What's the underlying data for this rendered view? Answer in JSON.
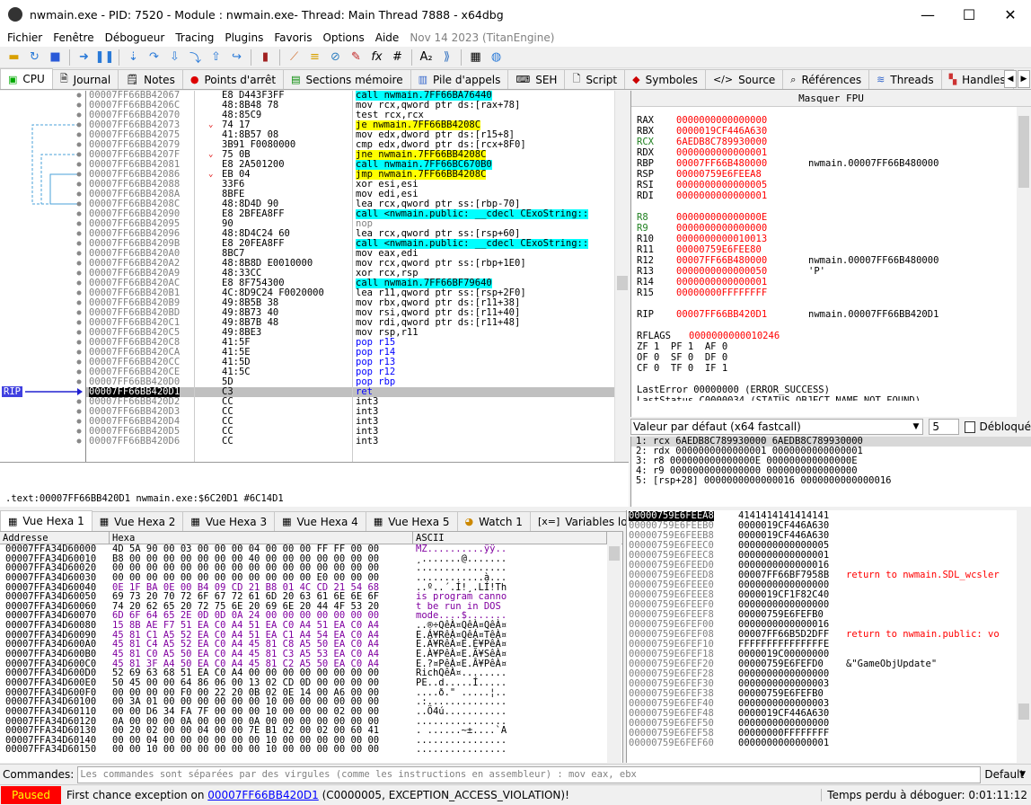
{
  "window": {
    "title": "nwmain.exe - PID: 7520 - Module : nwmain.exe- Thread: Main Thread 7888 - x64dbg",
    "minimize": "—",
    "maximize": "☐",
    "close": "✕"
  },
  "menu": [
    "Fichier",
    "Fenêtre",
    "Débogueur",
    "Tracing",
    "Plugins",
    "Favoris",
    "Options",
    "Aide"
  ],
  "menu_info": "Nov 14 2023 (TitanEngine)",
  "tabs": [
    {
      "label": "CPU",
      "icon": "cpu-icon"
    },
    {
      "label": "Journal",
      "icon": "journal-icon"
    },
    {
      "label": "Notes",
      "icon": "notes-icon"
    },
    {
      "label": "Points d'arrêt",
      "icon": "breakpoint-icon"
    },
    {
      "label": "Sections mémoire",
      "icon": "memory-icon"
    },
    {
      "label": "Pile d'appels",
      "icon": "callstack-icon"
    },
    {
      "label": "SEH",
      "icon": "seh-icon"
    },
    {
      "label": "Script",
      "icon": "script-icon"
    },
    {
      "label": "Symboles",
      "icon": "symbols-icon"
    },
    {
      "label": "Source",
      "icon": "source-icon"
    },
    {
      "label": "Références",
      "icon": "references-icon"
    },
    {
      "label": "Threads",
      "icon": "threads-icon"
    },
    {
      "label": "Handles",
      "icon": "handles-icon"
    }
  ],
  "rip_label": "RIP",
  "disasm": [
    {
      "a": "00007FF66BB42067",
      "b": "E8 D443F3FF",
      "i": "call nwmain.7FF66BA76440",
      "k": "call"
    },
    {
      "a": "00007FF66BB4206C",
      "b": "48:8B48 78",
      "i": "mov rcx,qword ptr ds:[rax+78]",
      "k": ""
    },
    {
      "a": "00007FF66BB42070",
      "b": "48:85C9",
      "i": "test rcx,rcx",
      "k": ""
    },
    {
      "a": "00007FF66BB42073",
      "b": "74 17",
      "i": "je nwmain.7FF66BB4208C",
      "k": "jmp"
    },
    {
      "a": "00007FF66BB42075",
      "b": "41:8B57 08",
      "i": "mov edx,dword ptr ds:[r15+8]",
      "k": ""
    },
    {
      "a": "00007FF66BB42079",
      "b": "3B91 F0080000",
      "i": "cmp edx,dword ptr ds:[rcx+8F0]",
      "k": ""
    },
    {
      "a": "00007FF66BB4207F",
      "b": "75 0B",
      "i": "jne nwmain.7FF66BB4208C",
      "k": "jmp"
    },
    {
      "a": "00007FF66BB42081",
      "b": "E8 2A501200",
      "i": "call nwmain.7FF66BC670B0",
      "k": "call"
    },
    {
      "a": "00007FF66BB42086",
      "b": "EB 04",
      "i": "jmp nwmain.7FF66BB4208C",
      "k": "jmp"
    },
    {
      "a": "00007FF66BB42088",
      "b": "33F6",
      "i": "xor esi,esi",
      "k": ""
    },
    {
      "a": "00007FF66BB4208A",
      "b": "8BFE",
      "i": "mov edi,esi",
      "k": ""
    },
    {
      "a": "00007FF66BB4208C",
      "b": "48:8D4D 90",
      "i": "lea rcx,qword ptr ss:[rbp-70]",
      "k": ""
    },
    {
      "a": "00007FF66BB42090",
      "b": "E8 2BFEA8FF",
      "i": "call <nwmain.public: __cdecl CExoString::",
      "k": "call"
    },
    {
      "a": "00007FF66BB42095",
      "b": "90",
      "i": "nop",
      "k": "nop"
    },
    {
      "a": "00007FF66BB42096",
      "b": "48:8D4C24 60",
      "i": "lea rcx,qword ptr ss:[rsp+60]",
      "k": ""
    },
    {
      "a": "00007FF66BB4209B",
      "b": "E8 20FEA8FF",
      "i": "call <nwmain.public: __cdecl CExoString::",
      "k": "call"
    },
    {
      "a": "00007FF66BB420A0",
      "b": "8BC7",
      "i": "mov eax,edi",
      "k": ""
    },
    {
      "a": "00007FF66BB420A2",
      "b": "48:8B8D E0010000",
      "i": "mov rcx,qword ptr ss:[rbp+1E0]",
      "k": ""
    },
    {
      "a": "00007FF66BB420A9",
      "b": "48:33CC",
      "i": "xor rcx,rsp",
      "k": ""
    },
    {
      "a": "00007FF66BB420AC",
      "b": "E8 8F754300",
      "i": "call nwmain.7FF66BF79640",
      "k": "call"
    },
    {
      "a": "00007FF66BB420B1",
      "b": "4C:8D9C24 F0020000",
      "i": "lea r11,qword ptr ss:[rsp+2F0]",
      "k": ""
    },
    {
      "a": "00007FF66BB420B9",
      "b": "49:8B5B 38",
      "i": "mov rbx,qword ptr ds:[r11+38]",
      "k": ""
    },
    {
      "a": "00007FF66BB420BD",
      "b": "49:8B73 40",
      "i": "mov rsi,qword ptr ds:[r11+40]",
      "k": ""
    },
    {
      "a": "00007FF66BB420C1",
      "b": "49:8B7B 48",
      "i": "mov rdi,qword ptr ds:[r11+48]",
      "k": ""
    },
    {
      "a": "00007FF66BB420C5",
      "b": "49:8BE3",
      "i": "mov rsp,r11",
      "k": ""
    },
    {
      "a": "00007FF66BB420C8",
      "b": "41:5F",
      "i": "pop r15",
      "k": "pop"
    },
    {
      "a": "00007FF66BB420CA",
      "b": "41:5E",
      "i": "pop r14",
      "k": "pop"
    },
    {
      "a": "00007FF66BB420CC",
      "b": "41:5D",
      "i": "pop r13",
      "k": "pop"
    },
    {
      "a": "00007FF66BB420CE",
      "b": "41:5C",
      "i": "pop r12",
      "k": "pop"
    },
    {
      "a": "00007FF66BB420D0",
      "b": "5D",
      "i": "pop rbp",
      "k": "pop"
    },
    {
      "a": "00007FF66BB420D1",
      "b": "C3",
      "i": "ret",
      "k": "ret",
      "cur": true
    },
    {
      "a": "00007FF66BB420D2",
      "b": "CC",
      "i": "int3",
      "k": ""
    },
    {
      "a": "00007FF66BB420D3",
      "b": "CC",
      "i": "int3",
      "k": ""
    },
    {
      "a": "00007FF66BB420D4",
      "b": "CC",
      "i": "int3",
      "k": ""
    },
    {
      "a": "00007FF66BB420D5",
      "b": "CC",
      "i": "int3",
      "k": ""
    },
    {
      "a": "00007FF66BB420D6",
      "b": "CC",
      "i": "int3",
      "k": ""
    }
  ],
  "regs_header": "Masquer FPU",
  "regs": [
    {
      "n": "RAX",
      "v": "0000000000000000",
      "c": ""
    },
    {
      "n": "RBX",
      "v": "0000019CF446A630",
      "c": ""
    },
    {
      "n": "RCX",
      "v": "6AEDB8C789930000",
      "c": ""
    },
    {
      "n": "RDX",
      "v": "0000000000000001",
      "c": ""
    },
    {
      "n": "RBP",
      "v": "00007FF66B480000",
      "c": "nwmain.00007FF66B480000"
    },
    {
      "n": "RSP",
      "v": "00000759E6FEEA8",
      "c": ""
    },
    {
      "n": "RSI",
      "v": "0000000000000005",
      "c": ""
    },
    {
      "n": "RDI",
      "v": "0000000000000001",
      "c": ""
    },
    {
      "n": "R8",
      "v": "000000000000000E",
      "c": ""
    },
    {
      "n": "R9",
      "v": "0000000000000000",
      "c": ""
    },
    {
      "n": "R10",
      "v": "0000000000010013",
      "c": ""
    },
    {
      "n": "R11",
      "v": "00000759E6FEE80",
      "c": ""
    },
    {
      "n": "R12",
      "v": "00007FF66B480000",
      "c": "nwmain.00007FF66B480000"
    },
    {
      "n": "R13",
      "v": "0000000000000050",
      "c": "'P'"
    },
    {
      "n": "R14",
      "v": "0000000000000001",
      "c": ""
    },
    {
      "n": "R15",
      "v": "00000000FFFFFFFF",
      "c": ""
    },
    {
      "n": "RIP",
      "v": "00007FF66BB420D1",
      "c": "nwmain.00007FF66BB420D1"
    }
  ],
  "rflags": {
    "label": "RFLAGS",
    "value": "0000000000010246"
  },
  "flags": [
    "ZF 1  PF 1  AF 0",
    "OF 0  SF 0  DF 0",
    "CF 0  TF 0  IF 1"
  ],
  "lasterror": "LastError  00000000 (ERROR_SUCCESS)",
  "laststatus": "LastStatus C0000034 (STATUS_OBJECT_NAME_NOT_FOUND)",
  "callconv": {
    "label": "Valeur par défaut (x64 fastcall)",
    "count": "5",
    "unlocked": "Débloqué"
  },
  "args": [
    "1: rcx 6AEDB8C789930000 6AEDB8C789930000",
    "2: rdx 0000000000000001 0000000000000001",
    "3: r8 000000000000000E 000000000000000E",
    "4: r9 0000000000000000 0000000000000000",
    "5: [rsp+28] 0000000000000016 0000000000000016"
  ],
  "info_line": ".text:00007FF66BB420D1 nwmain.exe:$6C20D1 #6C14D1",
  "dump_tabs": [
    {
      "label": "Vue Hexa 1",
      "icon": "dump-icon"
    },
    {
      "label": "Vue Hexa 2",
      "icon": "dump-icon"
    },
    {
      "label": "Vue Hexa 3",
      "icon": "dump-icon"
    },
    {
      "label": "Vue Hexa 4",
      "icon": "dump-icon"
    },
    {
      "label": "Vue Hexa 5",
      "icon": "dump-icon"
    },
    {
      "label": "Watch 1",
      "icon": "watch-icon"
    },
    {
      "label": "Variables lo",
      "icon": "locals-icon"
    }
  ],
  "dump_head": {
    "addr": "Addresse",
    "hex": "Hexa",
    "ascii": "ASCII"
  },
  "dump": [
    {
      "a": "00007FFA34D60000",
      "h": "4D 5A 90 00 03 00 00 00 04 00 00 00 FF FF 00 00",
      "s": "MZ..........ÿÿ.."
    },
    {
      "a": "00007FFA34D60010",
      "h": "B8 00 00 00 00 00 00 00 40 00 00 00 00 00 00 00",
      "s": "¸.......@......."
    },
    {
      "a": "00007FFA34D60020",
      "h": "00 00 00 00 00 00 00 00 00 00 00 00 00 00 00 00",
      "s": "................"
    },
    {
      "a": "00007FFA34D60030",
      "h": "00 00 00 00 00 00 00 00 00 00 00 00 E0 00 00 00",
      "s": "............à..."
    },
    {
      "a": "00007FFA34D60040",
      "h": "0E 1F BA 0E 00 B4 09 CD 21 B8 01 4C CD 21 54 68",
      "s": "..º..´.Í!¸.LÍ!Th"
    },
    {
      "a": "00007FFA34D60050",
      "h": "69 73 20 70 72 6F 67 72 61 6D 20 63 61 6E 6E 6F",
      "s": "is program canno"
    },
    {
      "a": "00007FFA34D60060",
      "h": "74 20 62 65 20 72 75 6E 20 69 6E 20 44 4F 53 20",
      "s": "t be run in DOS "
    },
    {
      "a": "00007FFA34D60070",
      "h": "6D 6F 64 65 2E 0D 0D 0A 24 00 00 00 00 00 00 00",
      "s": "mode....$......."
    },
    {
      "a": "00007FFA34D60080",
      "h": "15 8B AE F7 51 EA C0 A4 51 EA C0 A4 51 EA C0 A4",
      "s": "..®÷QêÀ¤QêÀ¤QêÀ¤"
    },
    {
      "a": "00007FFA34D60090",
      "h": "45 81 C1 A5 52 EA C0 A4 51 EA C1 A4 54 EA C0 A4",
      "s": "E.Á¥RêÀ¤QêÁ¤TêÀ¤"
    },
    {
      "a": "00007FFA34D600A0",
      "h": "45 81 C4 A5 52 EA C0 A4 45 81 C8 A5 50 EA C0 A4",
      "s": "E.Ä¥RêÀ¤E.È¥PêÀ¤"
    },
    {
      "a": "00007FFA34D600B0",
      "h": "45 81 C0 A5 50 EA C0 A4 45 81 C3 A5 53 EA C0 A4",
      "s": "E.À¥PêÀ¤E.Ã¥SêÀ¤"
    },
    {
      "a": "00007FFA34D600C0",
      "h": "45 81 3F A4 50 EA C0 A4 45 81 C2 A5 50 EA C0 A4",
      "s": "E.?¤PêÀ¤E.Â¥PêÀ¤"
    },
    {
      "a": "00007FFA34D600D0",
      "h": "52 69 63 68 51 EA C0 A4 00 00 00 00 00 00 00 00",
      "s": "RichQêÀ¤........"
    },
    {
      "a": "00007FFA34D600E0",
      "h": "50 45 00 00 64 86 06 00 13 02 CD 0D 00 00 00 00",
      "s": "PE..d.....Í....."
    },
    {
      "a": "00007FFA34D600F0",
      "h": "00 00 00 00 F0 00 22 20 0B 02 0E 14 00 A6 00 00",
      "s": "....ð.\" .....¦.."
    },
    {
      "a": "00007FFA34D60100",
      "h": "00 3A 01 00 00 00 00 00 00 10 00 00 00 00 00 00",
      "s": ".:.............."
    },
    {
      "a": "00007FFA34D60110",
      "h": "00 00 D6 34 FA 7F 00 00 00 10 00 00 00 02 00 00",
      "s": "..Ö4ú..........."
    },
    {
      "a": "00007FFA34D60120",
      "h": "0A 00 00 00 0A 00 00 00 0A 00 00 00 00 00 00 00",
      "s": "................"
    },
    {
      "a": "00007FFA34D60130",
      "h": "00 20 02 00 00 04 00 00 7E B1 02 00 02 00 60 41",
      "s": ". ......~±....`A"
    },
    {
      "a": "00007FFA34D60140",
      "h": "00 00 04 00 00 00 00 00 00 10 00 00 00 00 00 00",
      "s": "................"
    },
    {
      "a": "00007FFA34D60150",
      "h": "00 00 10 00 00 00 00 00 00 10 00 00 00 00 00 00",
      "s": "................"
    }
  ],
  "stack": [
    {
      "a": "00000759E6FEEA8",
      "v": "4141414141414141",
      "c": "",
      "top": true
    },
    {
      "a": "00000759E6FEEB0",
      "v": "0000019CF446A630",
      "c": ""
    },
    {
      "a": "00000759E6FEEB8",
      "v": "0000019CF446A630",
      "c": ""
    },
    {
      "a": "00000759E6FEEC0",
      "v": "0000000000000005",
      "c": ""
    },
    {
      "a": "00000759E6FEEC8",
      "v": "0000000000000001",
      "c": ""
    },
    {
      "a": "00000759E6FEED0",
      "v": "0000000000000016",
      "c": ""
    },
    {
      "a": "00000759E6FEED8",
      "v": "00007FF66BF7958B",
      "c": "return to nwmain.SDL_wcsler"
    },
    {
      "a": "00000759E6FEEE0",
      "v": "0000000000000000",
      "c": ""
    },
    {
      "a": "00000759E6FEEE8",
      "v": "0000019CF1F82C40",
      "c": ""
    },
    {
      "a": "00000759E6FEEF0",
      "v": "0000000000000000",
      "c": ""
    },
    {
      "a": "00000759E6FEEF8",
      "v": "00000759E6FEFB0",
      "c": ""
    },
    {
      "a": "00000759E6FEF00",
      "v": "0000000000000016",
      "c": ""
    },
    {
      "a": "00000759E6FEF08",
      "v": "00007FF66B5D2DFF",
      "c": "return to nwmain.public: vo"
    },
    {
      "a": "00000759E6FEF10",
      "v": "FFFFFFFFFFFFFFFE",
      "c": ""
    },
    {
      "a": "00000759E6FEF18",
      "v": "0000019C00000000",
      "c": ""
    },
    {
      "a": "00000759E6FEF20",
      "v": "00000759E6FEFD0",
      "c": "&\"GameObjUpdate\""
    },
    {
      "a": "00000759E6FEF28",
      "v": "0000000000000000",
      "c": ""
    },
    {
      "a": "00000759E6FEF30",
      "v": "0000000000000003",
      "c": ""
    },
    {
      "a": "00000759E6FEF38",
      "v": "00000759E6FEFB0",
      "c": ""
    },
    {
      "a": "00000759E6FEF40",
      "v": "0000000000000003",
      "c": ""
    },
    {
      "a": "00000759E6FEF48",
      "v": "0000019CF446A630",
      "c": ""
    },
    {
      "a": "00000759E6FEF50",
      "v": "0000000000000000",
      "c": ""
    },
    {
      "a": "00000759E6FEF58",
      "v": "00000000FFFFFFFF",
      "c": ""
    },
    {
      "a": "00000759E6FEF60",
      "v": "0000000000000001",
      "c": ""
    }
  ],
  "cmd": {
    "label": "Commandes:",
    "placeholder": "Les commandes sont séparées par des virgules (comme les instructions en assembleur) : mov eax, ebx",
    "mode": "Default"
  },
  "status": {
    "state": "Paused",
    "msg_pre": "First chance exception on ",
    "msg_link": "00007FF66BB420D1",
    "msg_post": " (C0000005, EXCEPTION_ACCESS_VIOLATION)!",
    "time": "Temps perdu à déboguer: 0:01:11:12"
  },
  "colors": {
    "call": "#00ffff",
    "jump": "#ffff00",
    "paused_bg": "#ff0000",
    "paused_fg": "#ffff00",
    "reg_value": "#ff0000"
  }
}
